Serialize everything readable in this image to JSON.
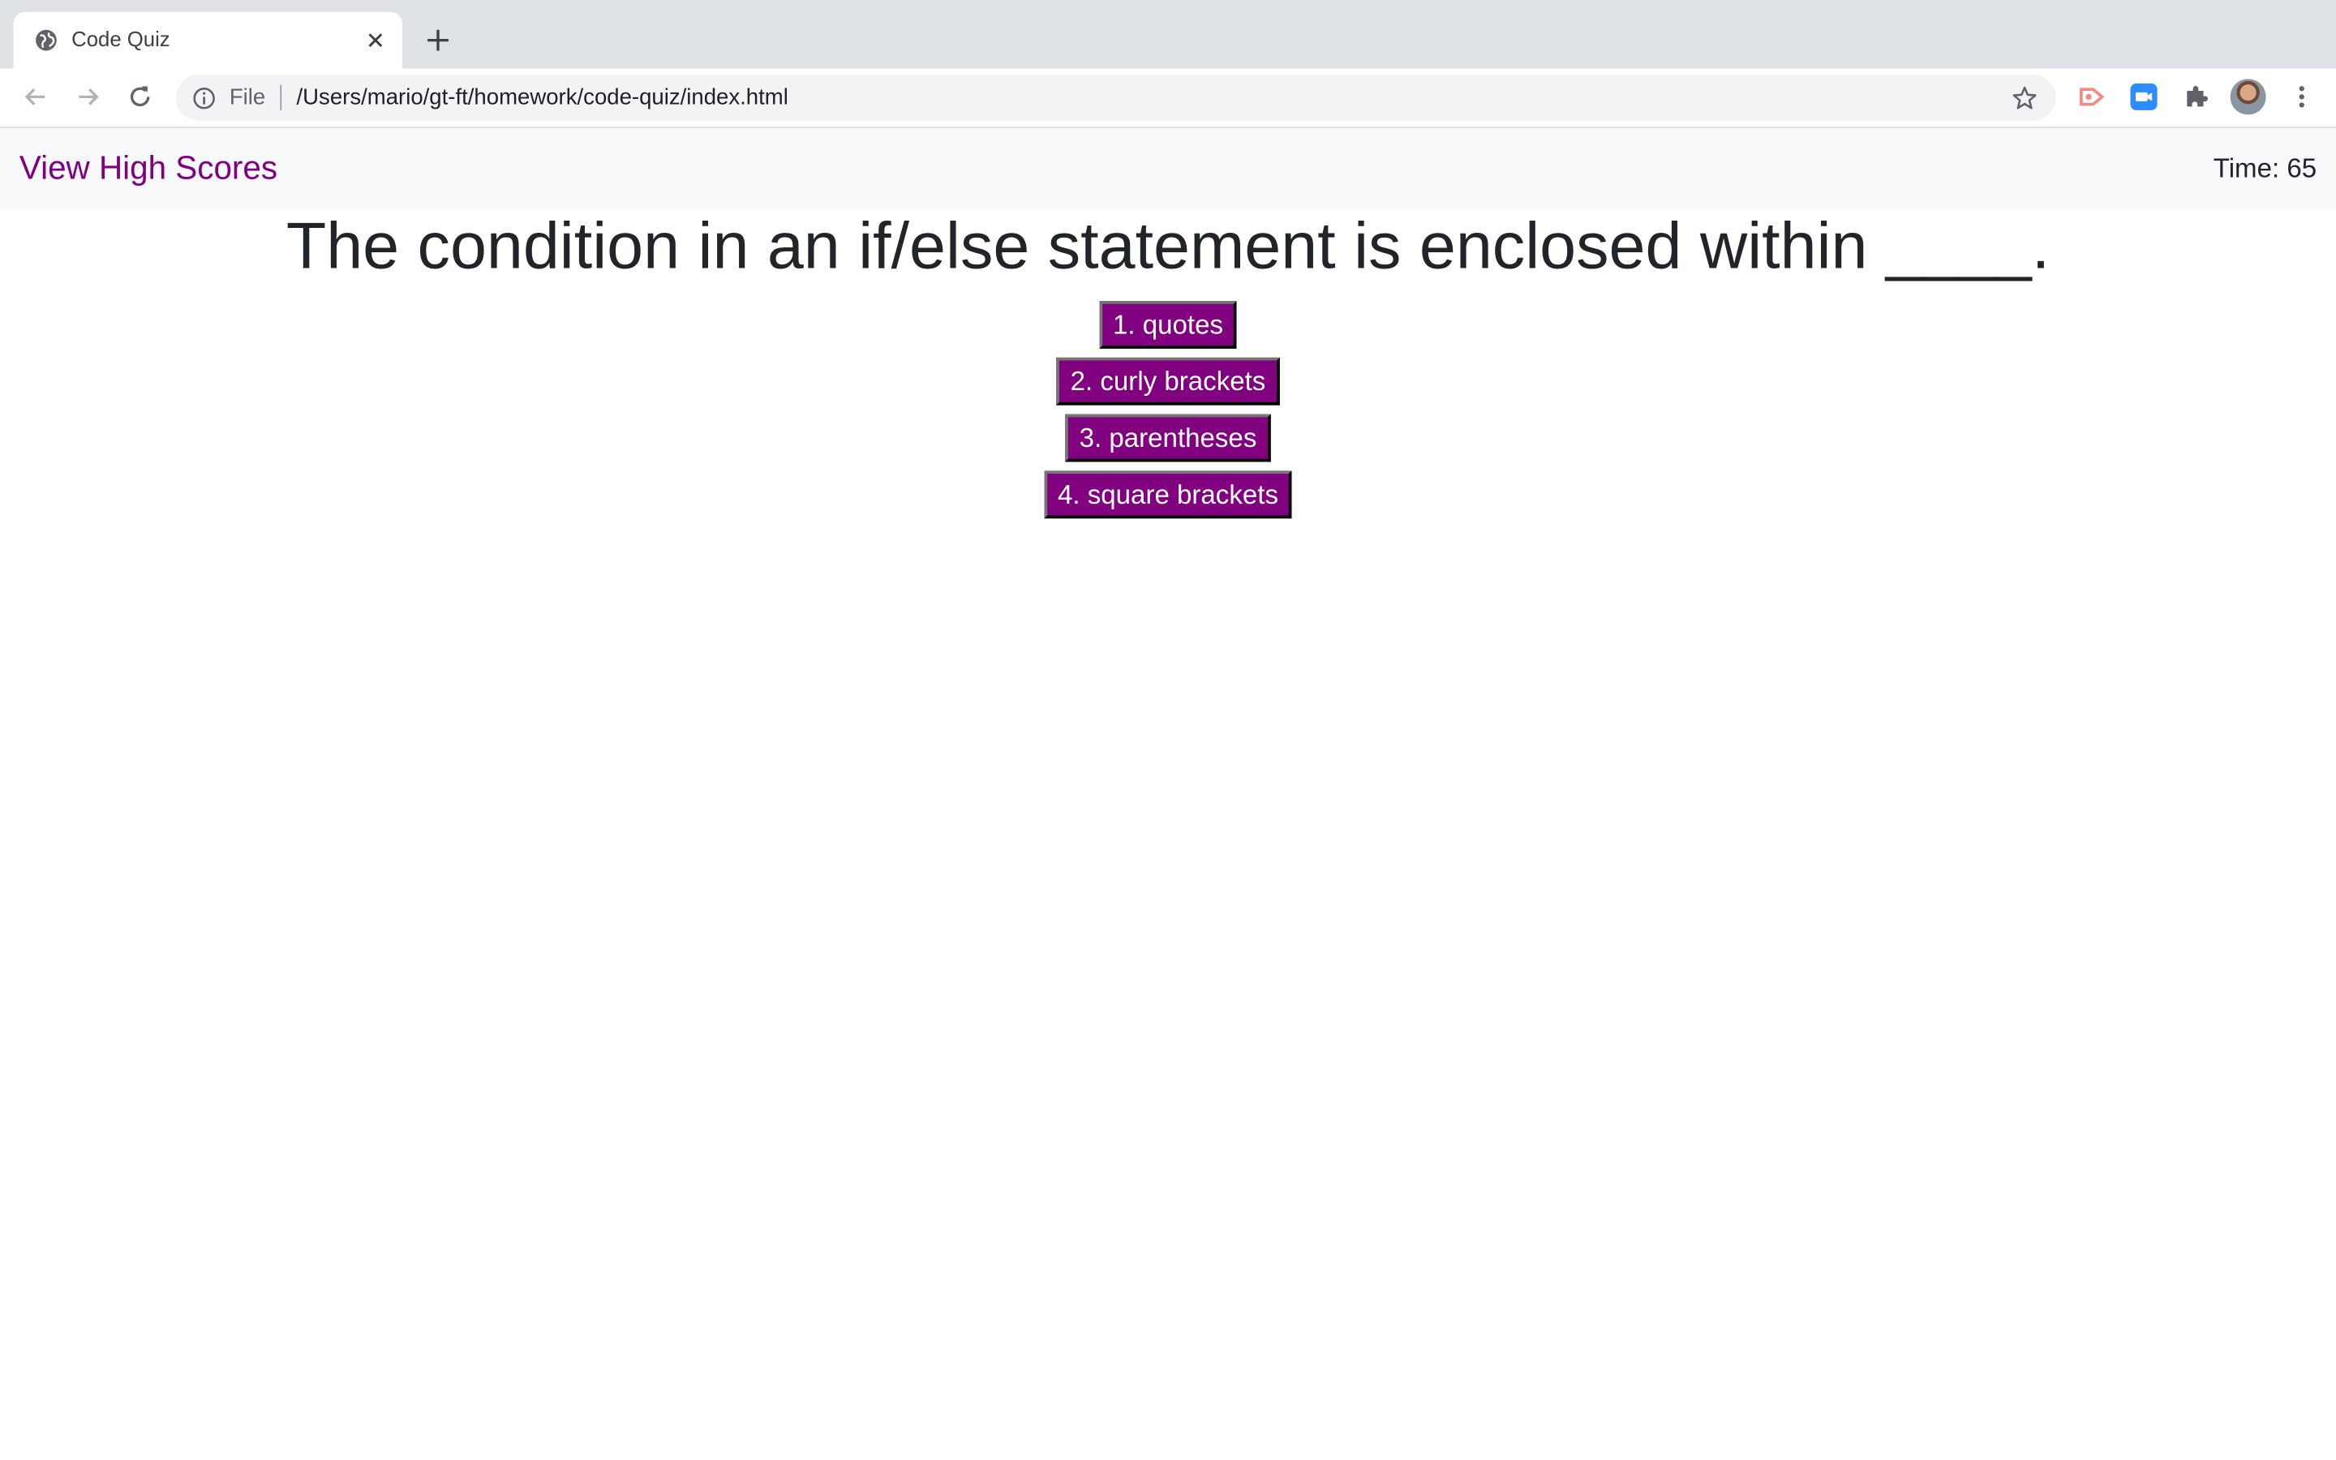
{
  "browser": {
    "tab": {
      "title": "Code Quiz",
      "favicon": "globe-icon",
      "close": "close-icon"
    },
    "new_tab": "plus-icon",
    "nav": {
      "back": "back-arrow-icon",
      "forward": "forward-arrow-icon",
      "reload": "reload-icon"
    },
    "omnibox": {
      "info_icon": "info-icon",
      "scheme_label": "File",
      "url": "/Users/mario/gt-ft/homework/code-quiz/index.html",
      "bookmark_icon": "star-icon"
    },
    "extensions": [
      "screencast-icon",
      "zoom-icon",
      "puzzle-icon"
    ],
    "profile": "avatar",
    "menu": "kebab-menu-icon"
  },
  "page": {
    "navbar": {
      "high_scores_link": "View High Scores",
      "timer": "Time: 65"
    },
    "question": "The condition in an if/else statement is enclosed within ____.",
    "answers": [
      "1. quotes",
      "2. curly brackets",
      "3. parentheses",
      "4. square brackets"
    ]
  },
  "colors": {
    "accent": "#800080",
    "text": "#212529",
    "navbar_bg": "#f8f9fa",
    "tabstrip_bg": "#dee1e6"
  }
}
